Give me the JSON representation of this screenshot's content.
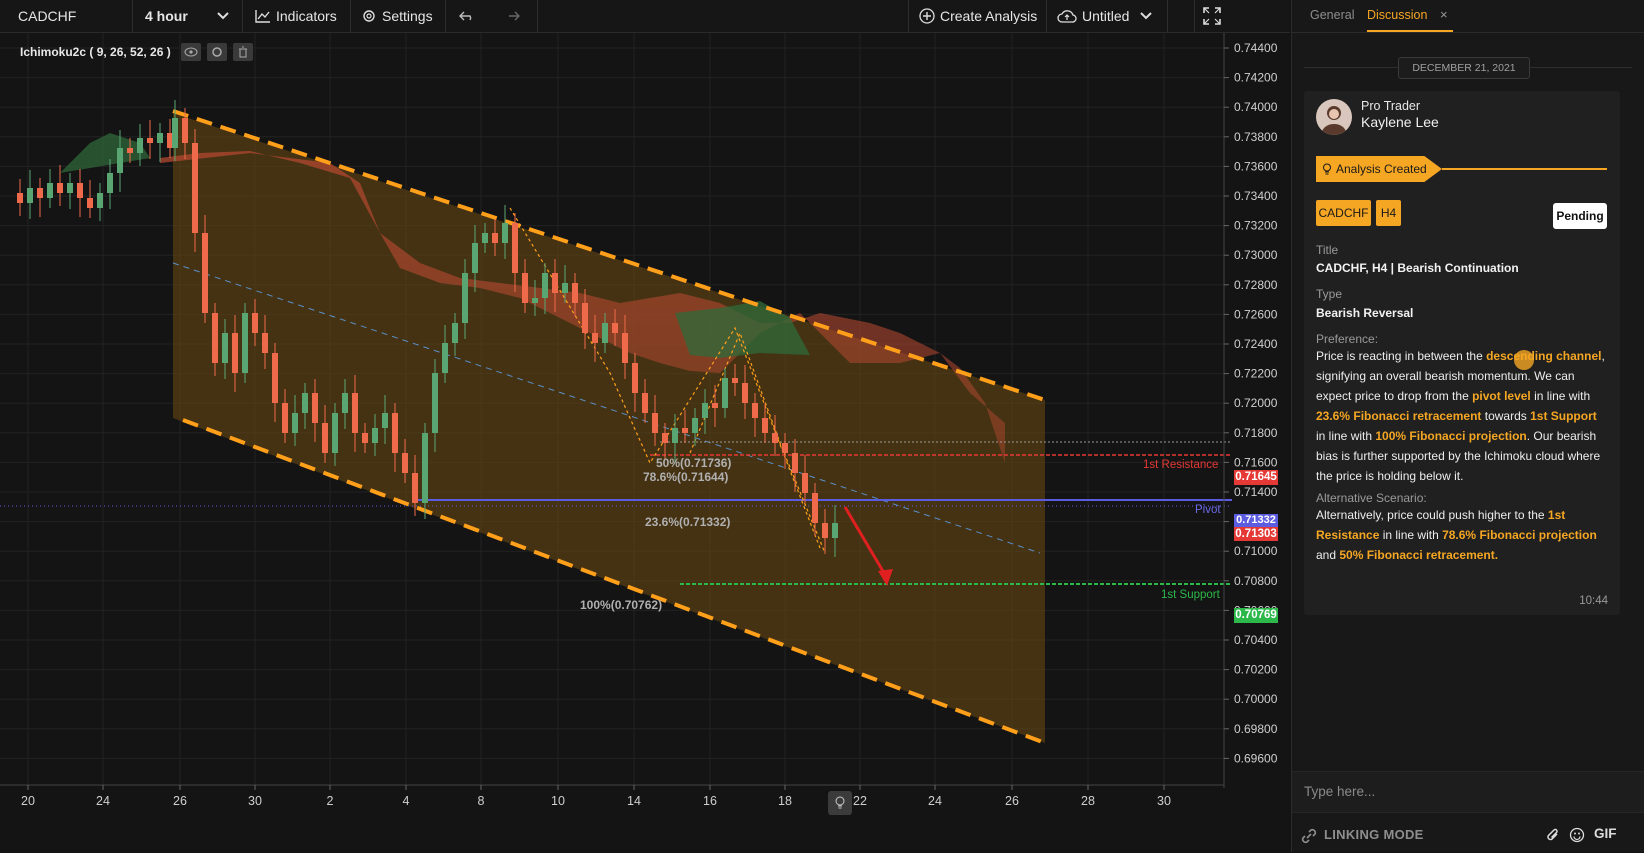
{
  "toolbar": {
    "symbol": "CADCHF",
    "timeframe": "4 hour",
    "indicators_label": "Indicators",
    "settings_label": "Settings",
    "create_analysis_label": "Create Analysis",
    "untitled_label": "Untitled"
  },
  "indicator": {
    "label": "Ichimoku2c ( 9, 26, 52, 26 )"
  },
  "price_axis": {
    "labels": [
      "0.74400",
      "0.74200",
      "0.74000",
      "0.73800",
      "0.73600",
      "0.73400",
      "0.73200",
      "0.73000",
      "0.72800",
      "0.72600",
      "0.72400",
      "0.72200",
      "0.72000",
      "0.71800",
      "0.71600",
      "0.71400",
      "0.71200",
      "0.71000",
      "0.70800",
      "0.70600",
      "0.70400",
      "0.70200",
      "0.70000",
      "0.69800",
      "0.69600"
    ],
    "tags": [
      {
        "text": "0.71645",
        "color": "#e53935"
      },
      {
        "text": "0.71332",
        "color": "#5c5ce0"
      },
      {
        "text": "0.71303",
        "color": "#e53935"
      },
      {
        "text": "0.70769",
        "color": "#2db84a"
      }
    ]
  },
  "time_axis": {
    "labels": [
      "20",
      "24",
      "26",
      "30",
      "2",
      "4",
      "8",
      "10",
      "14",
      "16",
      "18",
      "22",
      "24",
      "26",
      "28",
      "30"
    ]
  },
  "annotations": {
    "fib50": "50%(0.71736)",
    "fib786": "78.6%(0.71644)",
    "fib236": "23.6%(0.71332)",
    "fib100": "100%(0.70762)",
    "resistance": "1st Resistance",
    "pivot": "Pivot",
    "support": "1st Support"
  },
  "chart_data": {
    "type": "candlestick",
    "symbol": "CADCHF",
    "ylim": [
      0.6955,
      0.7445
    ],
    "levels": [
      {
        "name": "1st Resistance",
        "value": 0.71645
      },
      {
        "name": "Pivot",
        "value": 0.71332
      },
      {
        "name": "1st Support",
        "value": 0.70769
      }
    ],
    "fibonacci": [
      {
        "label": "50%",
        "value": 0.71736
      },
      {
        "label": "78.6%",
        "value": 0.71644
      },
      {
        "label": "23.6%",
        "value": 0.71332
      },
      {
        "label": "100%",
        "value": 0.70762
      }
    ],
    "last_price": 0.71303
  },
  "panel": {
    "tabs": [
      "General",
      "Discussion"
    ],
    "active_tab": "Discussion",
    "date": "DECEMBER 21, 2021",
    "author_role": "Pro Trader",
    "author_name": "Kaylene Lee",
    "event": "Analysis Created",
    "chips": [
      "CADCHF",
      "H4"
    ],
    "status": "Pending",
    "title_label": "Title",
    "title_value": "CADCHF, H4 | Bearish Continuation",
    "type_label": "Type",
    "type_value": "Bearish Reversal",
    "preference_label": "Preference:",
    "preference_parts": [
      "Price is reacting in between the ",
      "descending channel",
      ", signifying an overall bearish momentum. We can expect price to drop from the ",
      "pivot level",
      " in line with ",
      "23.6% Fibonacci retracement",
      " towards ",
      "1st Support",
      " in line with ",
      "100% Fibonacci projection",
      ". Our bearish bias is further supported by the Ichimoku cloud where the price is holding below it."
    ],
    "alternative_label": "Alternative Scenario:",
    "alternative_parts": [
      "Alternatively, price  could push higher to the ",
      "1st Resistance",
      " in line with ",
      "78.6% Fibonacci projection",
      " and ",
      "50% Fibonacci retracement."
    ],
    "time": "10:44",
    "input_placeholder": "Type here...",
    "linking_mode": "LINKING MODE",
    "gif_label": "GIF"
  },
  "colors": {
    "accent": "#f5a623",
    "bear": "#ef6a4a",
    "bull": "#5aa673"
  }
}
